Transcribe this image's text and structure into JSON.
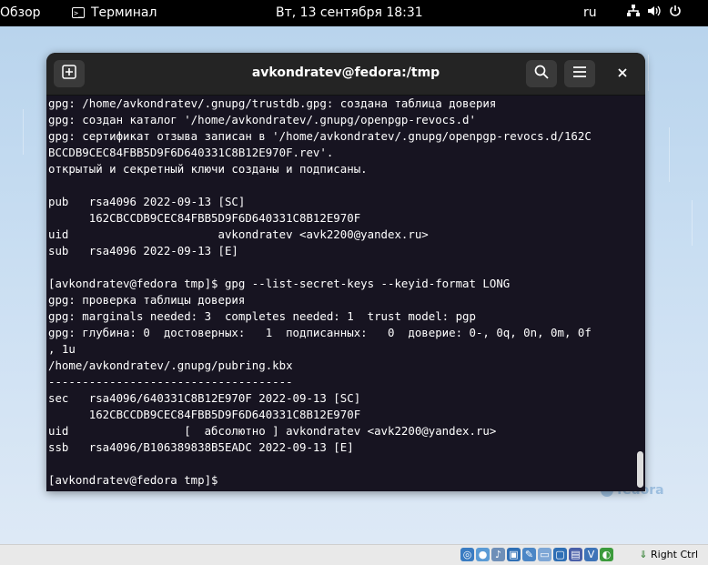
{
  "topbar": {
    "activities": "Обзор",
    "app_name": "Терминал",
    "clock": "Вт, 13 сентября  18:31",
    "language": "ru",
    "icons": [
      "network-icon",
      "volume-icon",
      "power-icon"
    ]
  },
  "window": {
    "title": "avkondratev@fedora:/tmp",
    "new_tab_icon": "new-tab-icon",
    "search_icon": "search-icon",
    "menu_icon": "hamburger-menu-icon",
    "close_icon": "close-icon"
  },
  "terminal": {
    "lines": [
      "gpg: /home/avkondratev/.gnupg/trustdb.gpg: создана таблица доверия",
      "gpg: создан каталог '/home/avkondratev/.gnupg/openpgp-revocs.d'",
      "gpg: сертификат отзыва записан в '/home/avkondratev/.gnupg/openpgp-revocs.d/162C",
      "BCCDB9CEC84FBB5D9F6D640331C8B12E970F.rev'.",
      "открытый и секретный ключи созданы и подписаны.",
      "",
      "pub   rsa4096 2022-09-13 [SC]",
      "      162CBCCDB9CEC84FBB5D9F6D640331C8B12E970F",
      "uid                      avkondratev <avk2200@yandex.ru>",
      "sub   rsa4096 2022-09-13 [E]",
      "",
      "[avkondratev@fedora tmp]$ gpg --list-secret-keys --keyid-format LONG",
      "gpg: проверка таблицы доверия",
      "gpg: marginals needed: 3  completes needed: 1  trust model: pgp",
      "gpg: глубина: 0  достоверных:   1  подписанных:   0  доверие: 0-, 0q, 0n, 0m, 0f",
      ", 1u",
      "/home/avkondratev/.gnupg/pubring.kbx",
      "------------------------------------",
      "sec   rsa4096/640331C8B12E970F 2022-09-13 [SC]",
      "      162CBCCDB9CEC84FBB5D9F6D640331C8B12E970F",
      "uid                 [  абсолютно ] avkondratev <avk2200@yandex.ru>",
      "ssb   rsa4096/B106389838B5EADC 2022-09-13 [E]",
      "",
      "[avkondratev@fedora tmp]$ "
    ]
  },
  "desktop": {
    "watermark": "fedora"
  },
  "vbox_statusbar": {
    "host_key": "Right Ctrl",
    "icons": [
      "hard-disk-icon",
      "optical-drive-icon",
      "audio-icon",
      "network-adapter-icon",
      "usb-icon",
      "shared-folder-icon",
      "display-icon",
      "video-capture-icon",
      "virtualization-icon",
      "mouse-integration-icon",
      "host-key-icon"
    ],
    "colors": {
      "accent": "#2f6fb5"
    }
  }
}
